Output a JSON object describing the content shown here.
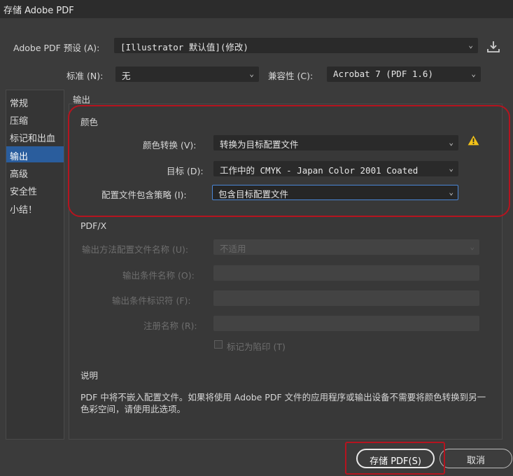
{
  "window": {
    "title": "存储 Adobe PDF"
  },
  "preset": {
    "label": "Adobe PDF 预设 (A):",
    "value": "[Illustrator 默认值](修改)"
  },
  "standard": {
    "label": "标准 (N):",
    "value": "无"
  },
  "compat": {
    "label": "兼容性 (C):",
    "value": "Acrobat 7 (PDF 1.6)"
  },
  "sidebar": {
    "items": [
      {
        "label": "常规"
      },
      {
        "label": "压缩"
      },
      {
        "label": "标记和出血"
      },
      {
        "label": "输出"
      },
      {
        "label": "高级"
      },
      {
        "label": "安全性"
      },
      {
        "label": "小结！"
      }
    ]
  },
  "output": {
    "section_title": "输出",
    "color_title": "颜色",
    "color_conversion_label": "颜色转换 (V):",
    "color_conversion_value": "转换为目标配置文件",
    "destination_label": "目标 (D):",
    "destination_value": "工作中的 CMYK - Japan Color 2001 Coated",
    "profile_policy_label": "配置文件包含策略 (I):",
    "profile_policy_value": "包含目标配置文件"
  },
  "pdfx": {
    "title": "PDF/X",
    "intent_profile_label": "输出方法配置文件名称 (U):",
    "intent_profile_value": "不适用",
    "condition_name_label": "输出条件名称 (O):",
    "condition_id_label": "输出条件标识符 (F):",
    "registry_label": "注册名称 (R):",
    "trapped_label": "标记为陷印 (T)"
  },
  "description": {
    "title": "说明",
    "text": "PDF 中将不嵌入配置文件。如果将使用 Adobe PDF 文件的应用程序或输出设备不需要将颜色转换到另一色彩空间，请使用此选项。"
  },
  "buttons": {
    "save": "存储 PDF(S)",
    "cancel": "取消"
  },
  "icons": {
    "warning": "warning-icon",
    "download": "download-icon",
    "chevron": "chevron-down-icon"
  },
  "colors": {
    "accent": "#2a5d9d",
    "highlight_red": "#b5141f",
    "warning": "#f2c218"
  }
}
